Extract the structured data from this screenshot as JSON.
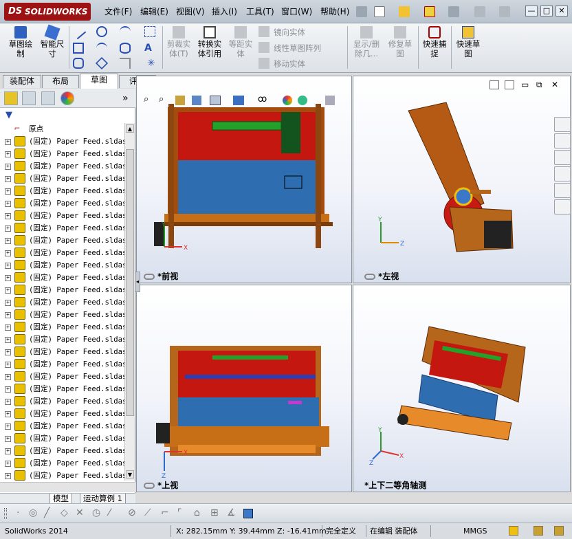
{
  "app": {
    "logo_text": "SOLIDWORKS",
    "logo_mark": "DS",
    "status_app": "SolidWorks 2014"
  },
  "menu": [
    "文件(F)",
    "编辑(E)",
    "视图(V)",
    "插入(I)",
    "工具(T)",
    "窗口(W)",
    "帮助(H)"
  ],
  "window_buttons": [
    "—",
    "□",
    "✕"
  ],
  "command_manager": {
    "sketch": "草图绘制",
    "smart_dim": "智能尺寸",
    "trim": "剪裁实体(T)",
    "convert": "转换实体引用",
    "offset": "等距实体",
    "mirror": "镜向实体",
    "linear_pattern": "线性草图阵列",
    "move": "移动实体",
    "show_delete": "显示/删除几...",
    "repair": "修复草图",
    "quick_snap": "快速捕捉",
    "quick_sketch": "快速草图"
  },
  "tabs": [
    "装配体",
    "布局",
    "草图",
    "评估"
  ],
  "active_tab": "草图",
  "tree": {
    "origin": "原点",
    "items": [
      "(固定) Paper Feed.sldas",
      "(固定) Paper Feed.sldas",
      "(固定) Paper Feed.sldas",
      "(固定) Paper Feed.sldas",
      "(固定) Paper Feed.sldas",
      "(固定) Paper Feed.sldas",
      "(固定) Paper Feed.sldas",
      "(固定) Paper Feed.sldas",
      "(固定) Paper Feed.sldas",
      "(固定) Paper Feed.sldas",
      "(固定) Paper Feed.sldas",
      "(固定) Paper Feed.sldas",
      "(固定) Paper Feed.sldas",
      "(固定) Paper Feed.sldas",
      "(固定) Paper Feed.sldas",
      "(固定) Paper Feed.sldas",
      "(固定) Paper Feed.sldas",
      "(固定) Paper Feed.sldas",
      "(固定) Paper Feed.sldas",
      "(固定) Paper Feed.sldas",
      "(固定) Paper Feed.sldas",
      "(固定) Paper Feed.sldas",
      "(固定) Paper Feed.sldas",
      "(固定) Paper Feed.sldas",
      "(固定) Paper Feed.sldas",
      "(固定) Paper Feed.sldas",
      "(固定) Paper Feed.sldas",
      "(固定) Paper Feed.sldas",
      "(固定) Paper Feed.sldas"
    ]
  },
  "bottom_tabs": [
    "模型",
    "运动算例 1"
  ],
  "viewports": {
    "front": "*前视",
    "left": "*左视",
    "top": "*上视",
    "iso": "*上下二等角轴测"
  },
  "axes": {
    "x": "X",
    "y": "Y",
    "z": "Z"
  },
  "status": {
    "coords": "X: 282.15mm Y: 39.44mm Z: -16.41mm",
    "defined": "完全定义",
    "editing": "在编辑 装配体",
    "units": "MMGS"
  },
  "colors": {
    "accent": "#9d1313",
    "tree_icon": "#e8c000"
  }
}
